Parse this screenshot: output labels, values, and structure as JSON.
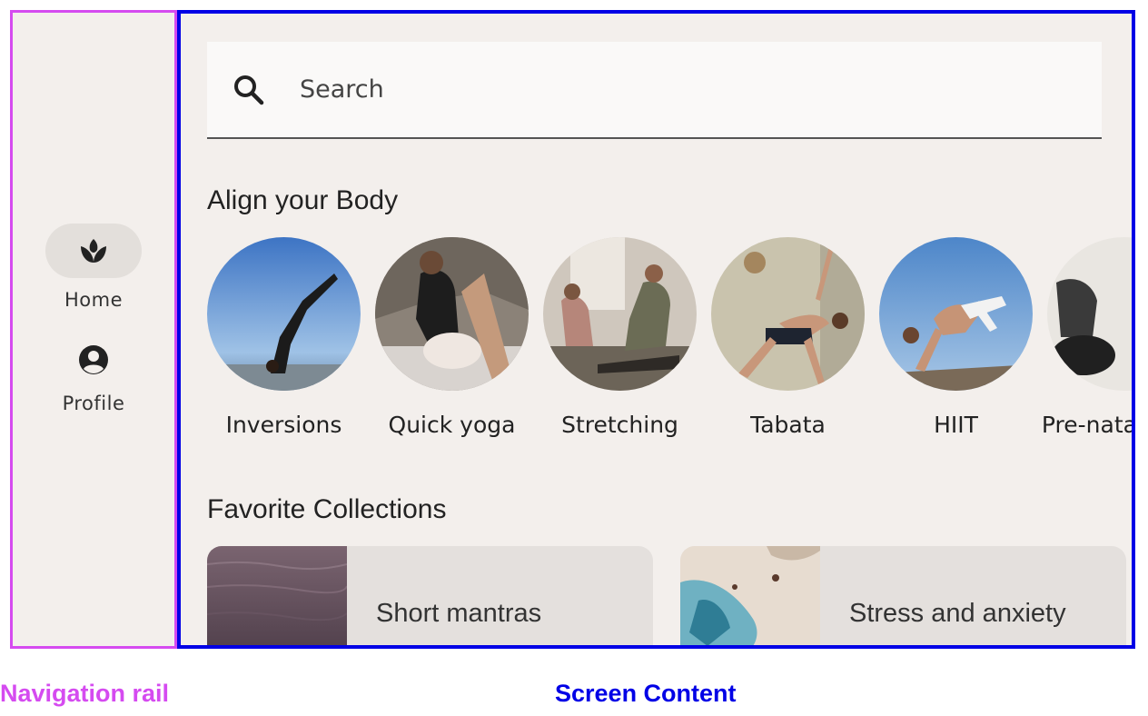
{
  "navigation_rail": {
    "items": [
      {
        "label": "Home",
        "icon": "spa-icon",
        "active": true
      },
      {
        "label": "Profile",
        "icon": "account-circle-icon",
        "active": false
      }
    ]
  },
  "search": {
    "placeholder": "Search"
  },
  "sections": {
    "align_body": {
      "title": "Align your Body",
      "items": [
        {
          "label": "Inversions"
        },
        {
          "label": "Quick yoga"
        },
        {
          "label": "Stretching"
        },
        {
          "label": "Tabata"
        },
        {
          "label": "HIIT"
        },
        {
          "label": "Pre-natal yoga"
        }
      ]
    },
    "favorite_collections": {
      "title": "Favorite Collections",
      "items": [
        {
          "label": "Short mantras"
        },
        {
          "label": "Stress and anxiety"
        }
      ]
    }
  },
  "annotations": {
    "rail": "Navigation rail",
    "content": "Screen Content"
  },
  "colors": {
    "rail_outline": "#d54bf0",
    "content_outline": "#0000e6",
    "surface": "#f3efec"
  }
}
